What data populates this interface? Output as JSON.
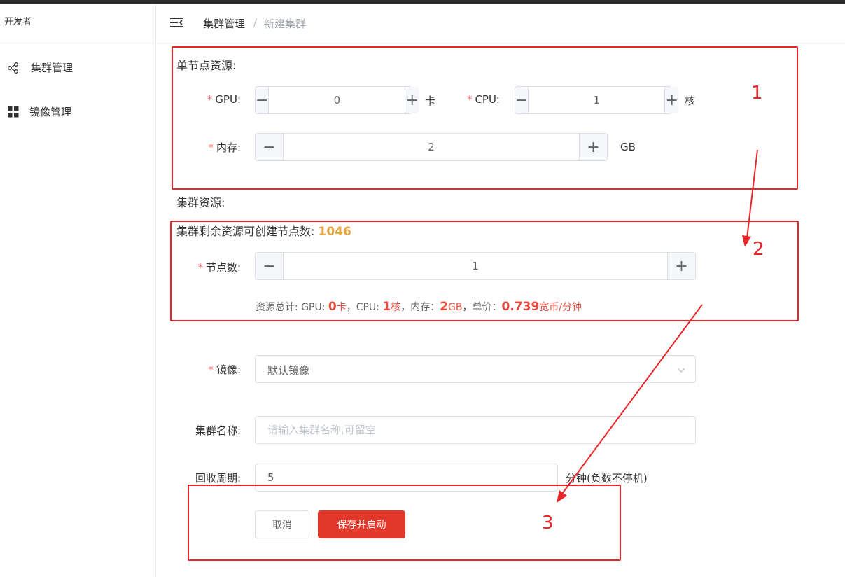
{
  "sidebar": {
    "brand": "开发者",
    "items": [
      {
        "label": "集群管理",
        "icon": "share-nodes-icon"
      },
      {
        "label": "镜像管理",
        "icon": "grid-icon"
      }
    ]
  },
  "header": {
    "breadcrumb": [
      "集群管理",
      "新建集群"
    ],
    "separator": "/"
  },
  "form": {
    "node_section_title": "单节点资源:",
    "required_mark": "*",
    "gpu": {
      "label": "GPU:",
      "value": "0",
      "unit": "卡"
    },
    "cpu": {
      "label": "CPU:",
      "value": "1",
      "unit": "核"
    },
    "memory": {
      "label": "内存:",
      "value": "2",
      "unit": "GB"
    },
    "cluster_section_title": "集群资源:",
    "remaining_text": "集群剩余资源可创建节点数:",
    "remaining_count": "1046",
    "nodes": {
      "label": "节点数:",
      "value": "1"
    },
    "summary": {
      "prefix": "资源总计: GPU: ",
      "gpu": "0",
      "gpu_unit": "卡",
      "cpu_text": "，CPU: ",
      "cpu": "1",
      "cpu_unit": "核",
      "mem_text": "，内存：",
      "mem": "2",
      "mem_unit": "GB",
      "price_text": "，单价：",
      "price": "0.739",
      "price_unit": "宽币/分钟"
    },
    "image": {
      "label": "镜像:",
      "selected": "默认镜像"
    },
    "name": {
      "label": "集群名称:",
      "placeholder": "请输入集群名称,可留空",
      "value": ""
    },
    "recycle": {
      "label": "回收周期:",
      "value": "5",
      "suffix": "分钟(负数不停机)"
    },
    "cancel_label": "取消",
    "submit_label": "保存并启动"
  },
  "annotations": [
    "1",
    "2",
    "3"
  ],
  "colors": {
    "accent": "#e0392b",
    "annotation": "#e8262a",
    "count": "#e6a23c"
  }
}
